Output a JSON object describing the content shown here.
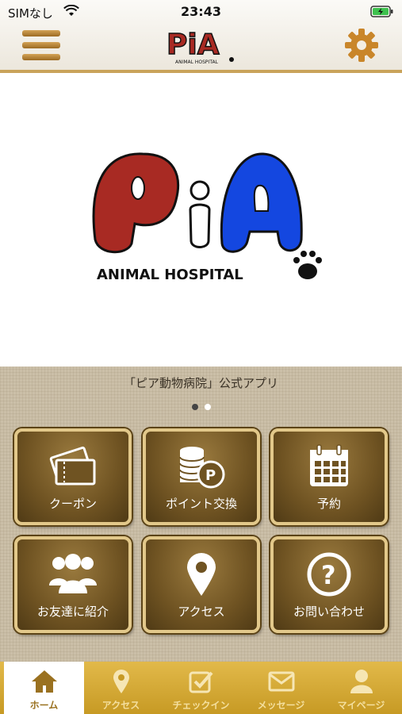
{
  "status_bar": {
    "carrier": "SIMなし",
    "time": "23:43"
  },
  "header": {
    "logo_text": "PiA",
    "logo_subtext": "ANIMAL HOSPITAL"
  },
  "hero": {
    "logo_text": "PiA",
    "logo_subtext": "ANIMAL HOSPITAL"
  },
  "carousel": {
    "caption": "「ピア動物病院」公式アプリ",
    "dots": 2,
    "active_index": 0
  },
  "tiles": [
    {
      "label": "クーポン",
      "icon": "ticket-icon"
    },
    {
      "label": "ポイント交換",
      "icon": "coins-icon"
    },
    {
      "label": "予約",
      "icon": "calendar-icon"
    },
    {
      "label": "お友達に紹介",
      "icon": "people-icon"
    },
    {
      "label": "アクセス",
      "icon": "map-pin-icon"
    },
    {
      "label": "お問い合わせ",
      "icon": "question-icon"
    }
  ],
  "tabbar": [
    {
      "label": "ホーム",
      "icon": "home-icon",
      "active": true
    },
    {
      "label": "アクセス",
      "icon": "map-pin-icon",
      "active": false
    },
    {
      "label": "チェックイン",
      "icon": "checkin-icon",
      "active": false
    },
    {
      "label": "メッセージ",
      "icon": "mail-icon",
      "active": false
    },
    {
      "label": "マイページ",
      "icon": "user-icon",
      "active": false
    }
  ],
  "colors": {
    "accent_gold": "#c79a24",
    "logo_red": "#a82a23",
    "logo_blue": "#1447e0"
  }
}
